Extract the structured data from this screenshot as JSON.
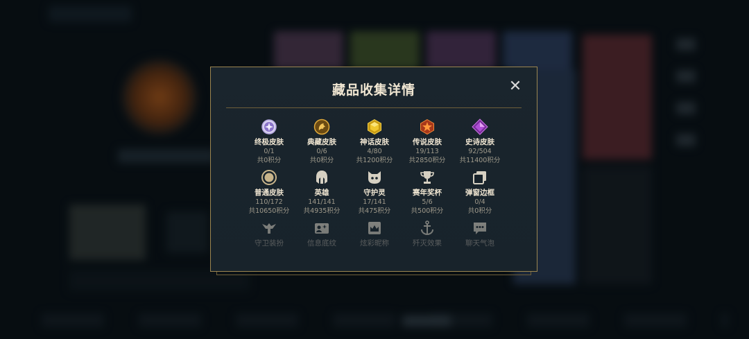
{
  "dialog": {
    "title": "藏品收集详情",
    "close_label": "✕"
  },
  "colors": {
    "gold_border": "#9c8650",
    "title_text": "#f0e6d2",
    "sub_text": "#a09b8c",
    "panel_bg": "#1a252d"
  },
  "rows": [
    [
      {
        "icon": "ultimate-skin-icon",
        "name": "终极皮肤",
        "count": "0/1",
        "points": "共0积分"
      },
      {
        "icon": "legacy-skin-icon",
        "name": "典藏皮肤",
        "count": "0/6",
        "points": "共0积分"
      },
      {
        "icon": "mythic-skin-icon",
        "name": "神话皮肤",
        "count": "4/80",
        "points": "共1200积分"
      },
      {
        "icon": "legendary-skin-icon",
        "name": "传说皮肤",
        "count": "19/113",
        "points": "共2850积分"
      },
      {
        "icon": "epic-skin-icon",
        "name": "史诗皮肤",
        "count": "92/504",
        "points": "共11400积分"
      }
    ],
    [
      {
        "icon": "standard-skin-icon",
        "name": "普通皮肤",
        "count": "110/172",
        "points": "共10650积分"
      },
      {
        "icon": "champion-helmet-icon",
        "name": "英雄",
        "count": "141/141",
        "points": "共4935积分"
      },
      {
        "icon": "guardian-spirit-icon",
        "name": "守护灵",
        "count": "17/141",
        "points": "共475积分"
      },
      {
        "icon": "trophy-icon",
        "name": "赛年奖杯",
        "count": "5/6",
        "points": "共500积分"
      },
      {
        "icon": "frame-icon",
        "name": "弹窗边框",
        "count": "0/4",
        "points": "共0积分"
      }
    ],
    [
      {
        "icon": "guardian-outfit-icon",
        "name": "守卫装扮"
      },
      {
        "icon": "info-card-icon",
        "name": "信息底纹"
      },
      {
        "icon": "colored-title-icon",
        "name": "炫彩昵称"
      },
      {
        "icon": "anchor-icon",
        "name": "歼灭效果"
      },
      {
        "icon": "chat-bubble-icon",
        "name": "聊天气泡"
      }
    ]
  ]
}
